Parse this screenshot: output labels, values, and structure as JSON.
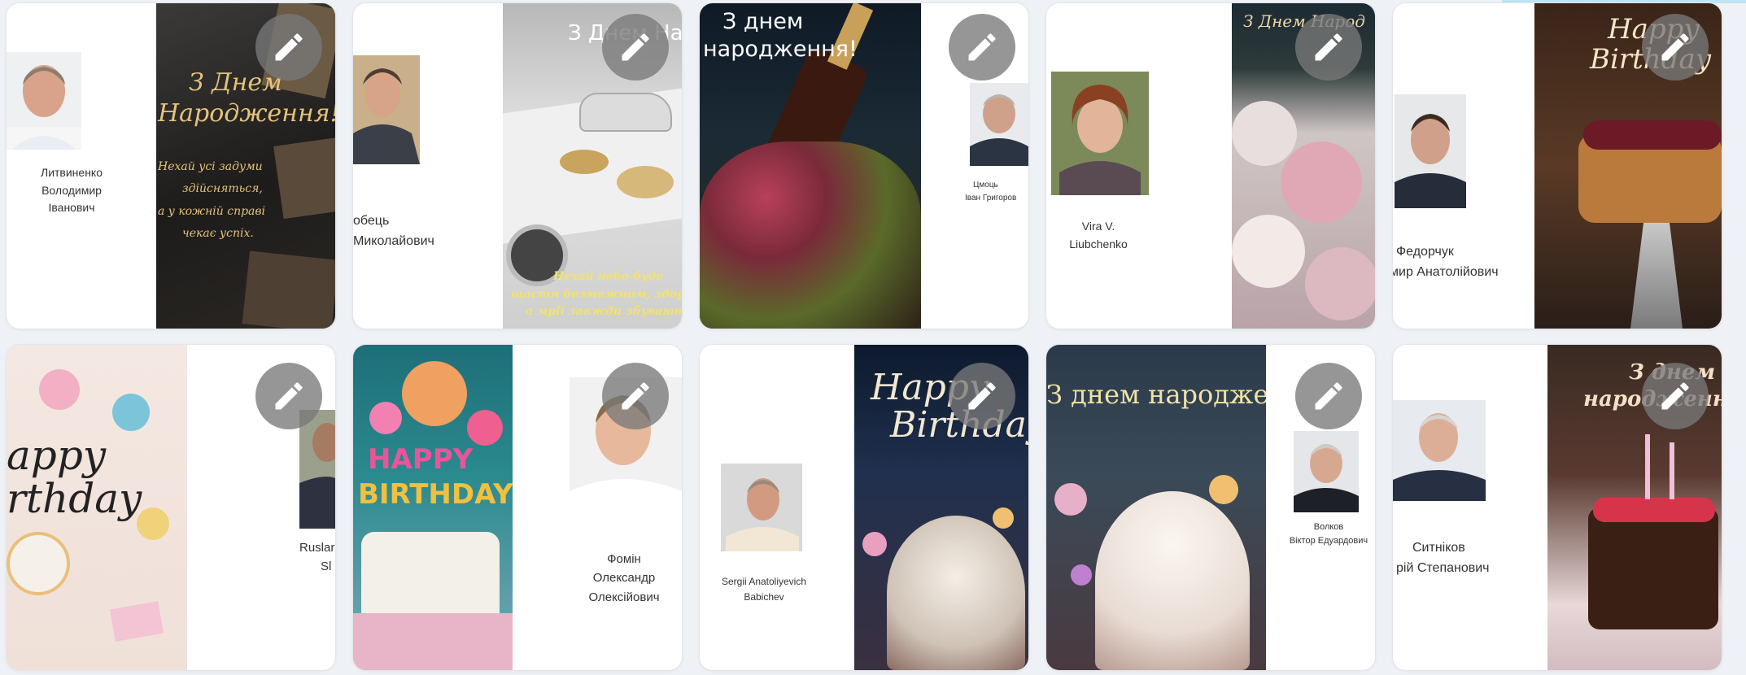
{
  "cards": [
    {
      "person": {
        "lines": [
          "Литвиненко",
          "Володимир",
          "Іванович"
        ]
      },
      "card_text": [
        "З Днем",
        "Народження!",
        "Нехай усі задуми",
        "здійсняться,",
        "а у кожній справі",
        "чекає успіх."
      ],
      "edit_icon": "pencil-icon"
    },
    {
      "person": {
        "lines": [
          "обець",
          "Миколайович"
        ]
      },
      "card_text": [
        "З Днем Нар",
        "Нехай небо буде",
        "щастя безмежним, здоро",
        "а мрії завжди збувают"
      ],
      "edit_icon": "pencil-icon"
    },
    {
      "person": {
        "lines": [
          "Цмоць",
          "Іван Григоров"
        ]
      },
      "card_text": [
        "З днем",
        "народження!"
      ],
      "edit_icon": "pencil-icon"
    },
    {
      "person": {
        "lines": [
          "Vira V.",
          "Liubchenko"
        ]
      },
      "card_text": [
        "З Днем Народ"
      ],
      "edit_icon": "pencil-icon"
    },
    {
      "person": {
        "lines": [
          "Федорчук",
          "мир Анатолійович"
        ]
      },
      "card_text": [
        "Happy",
        "Birthday"
      ],
      "edit_icon": "pencil-icon"
    },
    {
      "person": {
        "lines": [
          "Ruslar",
          "Sl"
        ]
      },
      "card_text": [
        "appy",
        "rthday"
      ],
      "edit_icon": "pencil-icon"
    },
    {
      "person": {
        "lines": [
          "Фомін",
          "Олександр",
          "Олексійович"
        ]
      },
      "card_text": [
        "HAPPY",
        "BIRTHDAY"
      ],
      "edit_icon": "pencil-icon"
    },
    {
      "person": {
        "lines": [
          "Sergii Anatoliyevich",
          "Babichev"
        ]
      },
      "card_text": [
        "Happy",
        "Birthday"
      ],
      "edit_icon": "pencil-icon"
    },
    {
      "person": {
        "lines": [
          "Волков",
          "Віктор Едуардович"
        ]
      },
      "card_text": [
        "З днем народження!"
      ],
      "edit_icon": "pencil-icon"
    },
    {
      "person": {
        "lines": [
          "Ситніков",
          "рій Степанович"
        ]
      },
      "card_text": [
        "З днем",
        "народження"
      ],
      "edit_icon": "pencil-icon"
    }
  ]
}
